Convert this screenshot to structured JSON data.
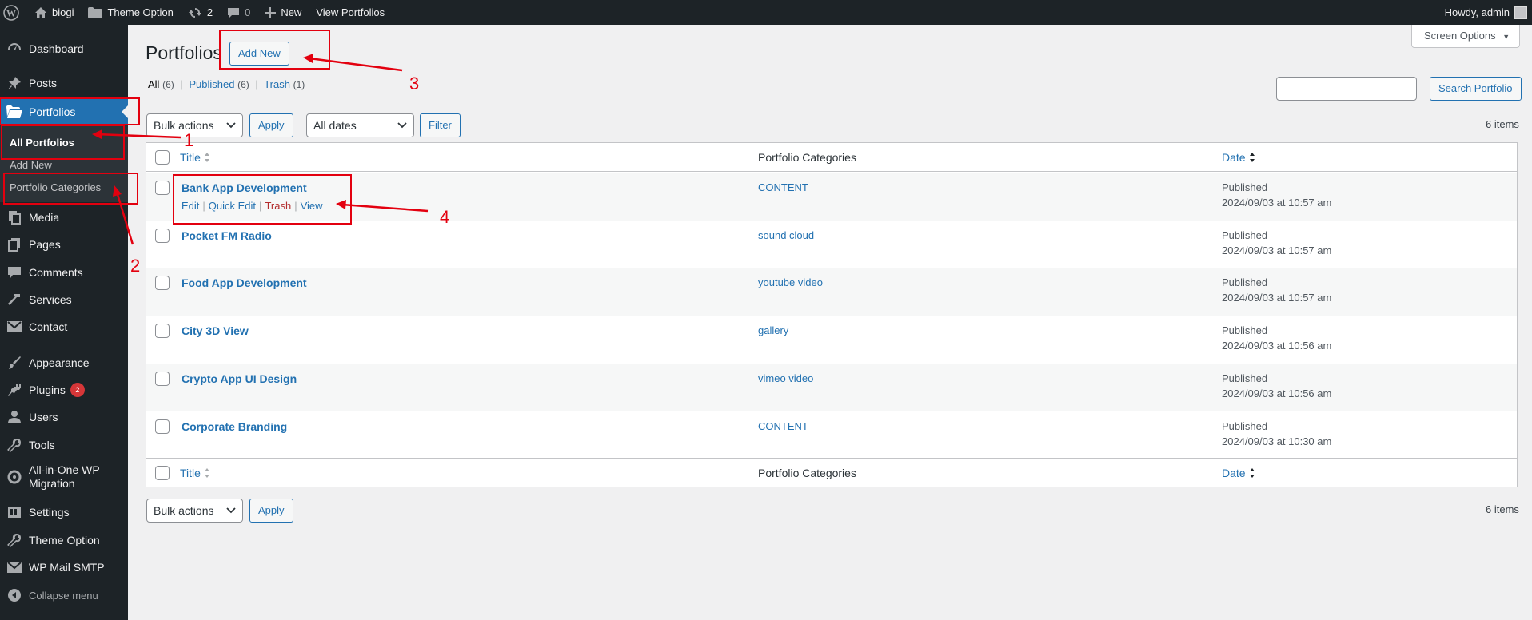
{
  "admin_bar": {
    "site_name": "biogi",
    "theme_option": "Theme Option",
    "updates_count": "2",
    "comments_count": "0",
    "new_label": "New",
    "view_label": "View Portfolios",
    "howdy": "Howdy, admin"
  },
  "sidebar": {
    "dashboard": "Dashboard",
    "posts": "Posts",
    "portfolios": "Portfolios",
    "sub_all": "All Portfolios",
    "sub_add": "Add New",
    "sub_categories": "Portfolio Categories",
    "media": "Media",
    "pages": "Pages",
    "comments": "Comments",
    "services": "Services",
    "contact": "Contact",
    "appearance": "Appearance",
    "plugins": "Plugins",
    "plugins_badge": "2",
    "users": "Users",
    "tools": "Tools",
    "migration_line1": "All-in-One WP",
    "migration_line2": "Migration",
    "settings": "Settings",
    "theme_option": "Theme Option",
    "wp_mail": "WP Mail SMTP",
    "collapse": "Collapse menu"
  },
  "header": {
    "title": "Portfolios",
    "add_new": "Add New",
    "screen_options": "Screen Options"
  },
  "views": {
    "all": "All",
    "all_count": "(6)",
    "published": "Published",
    "published_count": "(6)",
    "trash": "Trash",
    "trash_count": "(1)",
    "sep": "|"
  },
  "search": {
    "button": "Search Portfolio",
    "placeholder": ""
  },
  "tablenav": {
    "bulk_actions": "Bulk actions",
    "apply": "Apply",
    "all_dates": "All dates",
    "filter": "Filter",
    "items_count": "6 items"
  },
  "table": {
    "col_title": "Title",
    "col_categories": "Portfolio Categories",
    "col_date": "Date",
    "row_actions": {
      "edit": "Edit",
      "quick_edit": "Quick Edit",
      "trash": "Trash",
      "view": "View",
      "sep": "|"
    },
    "rows": [
      {
        "title": "Bank App Development",
        "category": "CONTENT",
        "status": "Published",
        "date": "2024/09/03 at 10:57 am"
      },
      {
        "title": "Pocket FM Radio",
        "category": "sound cloud",
        "status": "Published",
        "date": "2024/09/03 at 10:57 am"
      },
      {
        "title": "Food App Development",
        "category": "youtube video",
        "status": "Published",
        "date": "2024/09/03 at 10:57 am"
      },
      {
        "title": "City 3D View",
        "category": "gallery",
        "status": "Published",
        "date": "2024/09/03 at 10:56 am"
      },
      {
        "title": "Crypto App UI Design",
        "category": "vimeo video",
        "status": "Published",
        "date": "2024/09/03 at 10:56 am"
      },
      {
        "title": "Corporate Branding",
        "category": "CONTENT",
        "status": "Published",
        "date": "2024/09/03 at 10:30 am"
      }
    ]
  },
  "annotations": {
    "n1": "1",
    "n2": "2",
    "n3": "3",
    "n4": "4",
    "color": "#e3000f"
  },
  "colors": {
    "sidebar_bg": "#1d2327",
    "accent": "#2271b1",
    "trash_red": "#b32d2e",
    "page_bg": "#f0f0f1"
  }
}
